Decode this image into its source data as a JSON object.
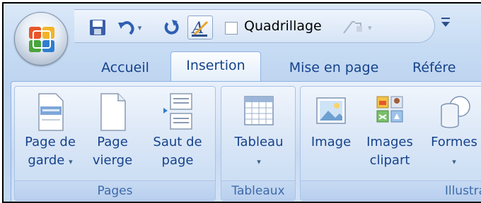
{
  "quick_access": {
    "save_icon": "save-icon",
    "undo_icon": "undo-icon",
    "redo_icon": "redo-icon",
    "text_format_icon": "text-format-icon",
    "checkbox_label": "Quadrillage",
    "customize_icon": "chevron-down-icon"
  },
  "tabs": [
    {
      "label": "Accueil"
    },
    {
      "label": "Insertion"
    },
    {
      "label": "Mise en page"
    },
    {
      "label": "Référe"
    }
  ],
  "groups": {
    "pages": {
      "label": "Pages",
      "buttons": [
        {
          "line1": "Page de",
          "line2": "garde",
          "arrow": "▾"
        },
        {
          "line1": "Page",
          "line2": "vierge"
        },
        {
          "line1": "Saut de",
          "line2": "page"
        }
      ]
    },
    "tableaux": {
      "label": "Tableaux",
      "buttons": [
        {
          "line1": "Tableau",
          "arrow": "▾"
        }
      ]
    },
    "illustrations": {
      "label": "Illustra",
      "buttons": [
        {
          "line1": "Image"
        },
        {
          "line1": "Images",
          "line2": "clipart"
        },
        {
          "line1": "Formes",
          "arrow": "▾"
        }
      ]
    }
  },
  "colors": {
    "tab_text": "#15428b",
    "ribbon_border": "#8db2e3"
  }
}
